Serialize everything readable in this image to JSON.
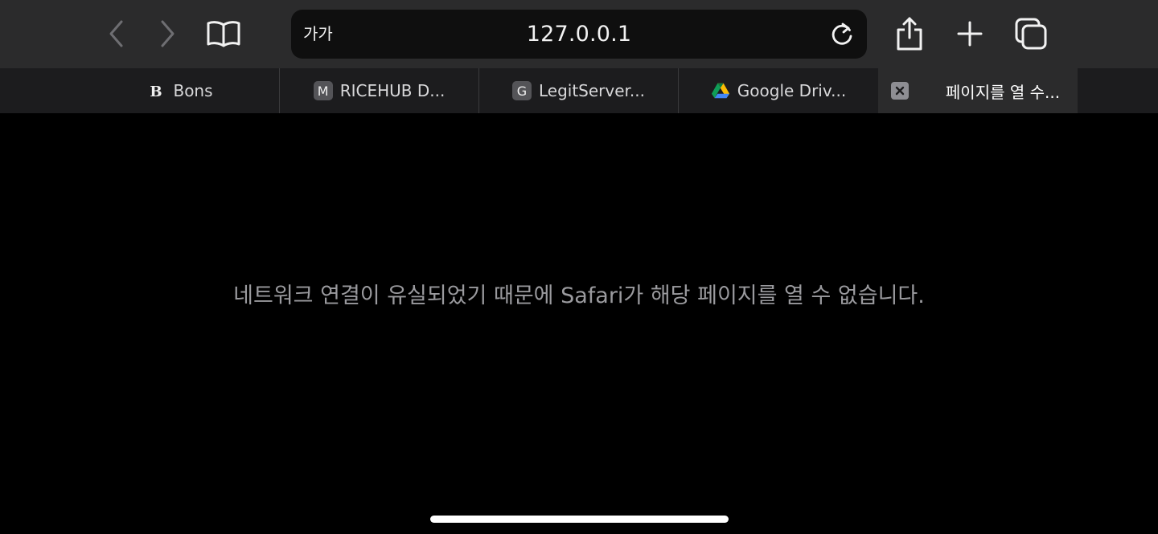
{
  "toolbar": {
    "back_icon": "chevron-left-icon",
    "forward_icon": "chevron-right-icon",
    "bookmarks_icon": "book-icon",
    "reader_label": "가가",
    "url": "127.0.0.1",
    "reload_icon": "reload-icon",
    "share_icon": "share-icon",
    "new_tab_icon": "plus-icon",
    "tabs_overview_icon": "tabs-icon"
  },
  "tabs": [
    {
      "title": "Bons",
      "favicon": "B"
    },
    {
      "title": "RICEHUB D...",
      "favicon": "M"
    },
    {
      "title": "LegitServer...",
      "favicon": "G"
    },
    {
      "title": "Google Driv...",
      "favicon": "google-drive-icon"
    },
    {
      "title": "페이지를 열 수...",
      "favicon": "close-icon",
      "active": true
    }
  ],
  "content": {
    "error_message": "네트워크 연결이 유실되었기 때문에 Safari가 해당 페이지를 열 수 없습니다."
  },
  "colors": {
    "toolbar_bg": "#2b2b2c",
    "tabbar_bg": "#1c1c1e",
    "page_bg": "#000000",
    "message_text": "#9a9a9e"
  }
}
